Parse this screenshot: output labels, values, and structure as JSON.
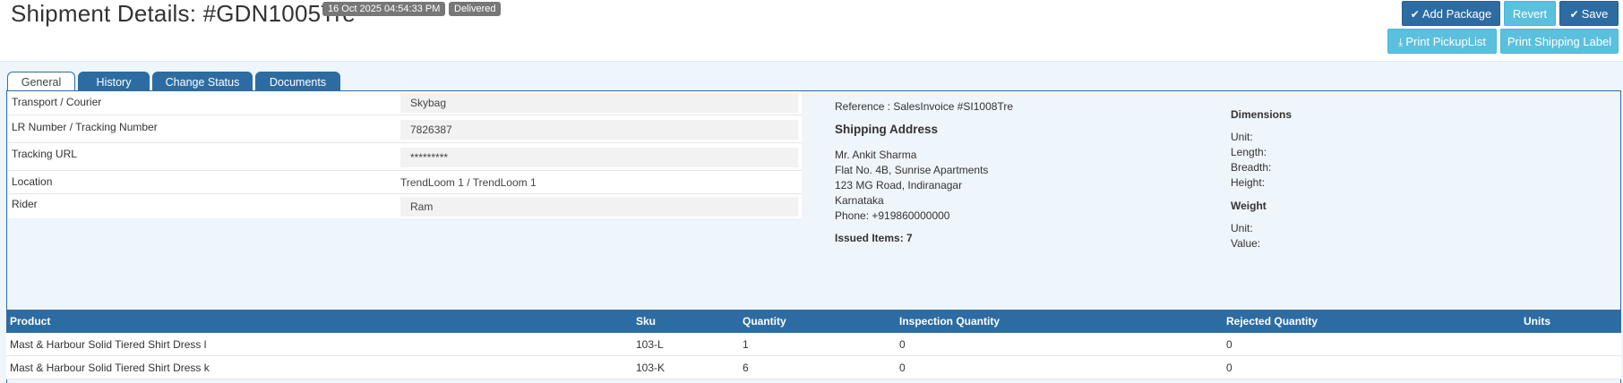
{
  "header": {
    "title": "Shipment Details: #GDN1005Tre",
    "date_badge": "16 Oct 2025 04:54:33 PM",
    "status_badge": "Delivered"
  },
  "actions": {
    "add_package": "Add Package",
    "revert": "Revert",
    "save": "Save",
    "print_picklist": "Print PickupList",
    "print_shipping_label": "Print Shipping Label"
  },
  "tabs": [
    {
      "label": "General",
      "active": true
    },
    {
      "label": "History",
      "active": false
    },
    {
      "label": "Change Status",
      "active": false
    },
    {
      "label": "Documents",
      "active": false
    }
  ],
  "general": {
    "fields": [
      {
        "label": "Transport / Courier",
        "value": "Skybag"
      },
      {
        "label": "LR Number / Tracking Number",
        "value": "7826387"
      },
      {
        "label": "Tracking URL",
        "value": "*********"
      },
      {
        "label": "Location",
        "value": "TrendLoom 1 / TrendLoom 1"
      },
      {
        "label": "Rider",
        "value": "Ram"
      }
    ],
    "reference": "Reference : SalesInvoice #SI1008Tre",
    "shipping_address": {
      "heading": "Shipping Address",
      "lines": [
        "Mr. Ankit Sharma",
        "Flat No. 4B, Sunrise Apartments",
        "123 MG Road, Indiranagar",
        "Karnataka",
        "Phone: +919860000000"
      ]
    },
    "issued_items": "Issued Items: 7",
    "dimensions": {
      "heading": "Dimensions",
      "unit": "Unit:",
      "length": "Length:",
      "breadth": "Breadth:",
      "height": "Height:"
    },
    "weight": {
      "heading": "Weight",
      "unit": "Unit:",
      "value": "Value:"
    }
  },
  "items_table": {
    "columns": [
      "Product",
      "Sku",
      "Quantity",
      "Inspection Quantity",
      "Rejected Quantity",
      "Units"
    ],
    "rows": [
      {
        "product": "Mast & Harbour Solid Tiered Shirt Dress l",
        "sku": "103-L",
        "quantity": "1",
        "inspection_quantity": "0",
        "rejected_quantity": "0",
        "units": ""
      },
      {
        "product": "Mast & Harbour Solid Tiered Shirt Dress k",
        "sku": "103-K",
        "quantity": "6",
        "inspection_quantity": "0",
        "rejected_quantity": "0",
        "units": ""
      }
    ]
  },
  "colors": {
    "primary": "#2d6ca2",
    "info": "#5bc0de",
    "badge": "#777777",
    "panel_bg": "#eef5fb"
  },
  "icons": {
    "add_package": "check-icon",
    "save": "check-icon",
    "print_picklist": "download-icon"
  }
}
